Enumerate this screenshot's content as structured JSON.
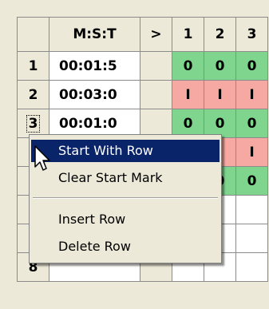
{
  "grid": {
    "header": {
      "row_col": "",
      "time_col": "M:S:T",
      "marker_col": ">",
      "cols": [
        "1",
        "2",
        "3"
      ]
    },
    "rows": [
      {
        "num": "1",
        "time": "00:01:5",
        "cells": [
          "0",
          "0",
          "0"
        ],
        "status": [
          "green",
          "green",
          "green"
        ]
      },
      {
        "num": "2",
        "time": "00:03:0",
        "cells": [
          "I",
          "I",
          "I"
        ],
        "status": [
          "red",
          "red",
          "red"
        ]
      },
      {
        "num": "3",
        "time": "00:01:0",
        "cells": [
          "0",
          "0",
          "0"
        ],
        "status": [
          "green",
          "green",
          "green"
        ]
      },
      {
        "num": "",
        "time": "",
        "cells": [
          "",
          "",
          "I"
        ],
        "status": [
          "red",
          "red",
          "red"
        ]
      },
      {
        "num": "",
        "time": "",
        "cells": [
          "",
          "0",
          "0"
        ],
        "status": [
          "green",
          "green",
          "green"
        ]
      },
      {
        "num": "",
        "time": "",
        "cells": [
          "",
          "",
          ""
        ],
        "status": [
          "white",
          "white",
          "white"
        ]
      },
      {
        "num": "",
        "time": "",
        "cells": [
          "",
          "",
          ""
        ],
        "status": [
          "white",
          "white",
          "white"
        ]
      },
      {
        "num": "8",
        "time": "",
        "cells": [
          "",
          "",
          ""
        ],
        "status": [
          "white",
          "white",
          "white"
        ]
      }
    ]
  },
  "context_menu": {
    "items": [
      {
        "label": "Start With Row",
        "highlighted": true
      },
      {
        "label": "Clear Start Mark",
        "highlighted": false
      },
      {
        "label": "Insert Row",
        "highlighted": false
      },
      {
        "label": "Delete Row",
        "highlighted": false
      }
    ]
  },
  "colors": {
    "green": "#7fd48e",
    "red": "#f6a9a2",
    "highlight": "#0a246a",
    "chrome": "#ece9d8"
  }
}
